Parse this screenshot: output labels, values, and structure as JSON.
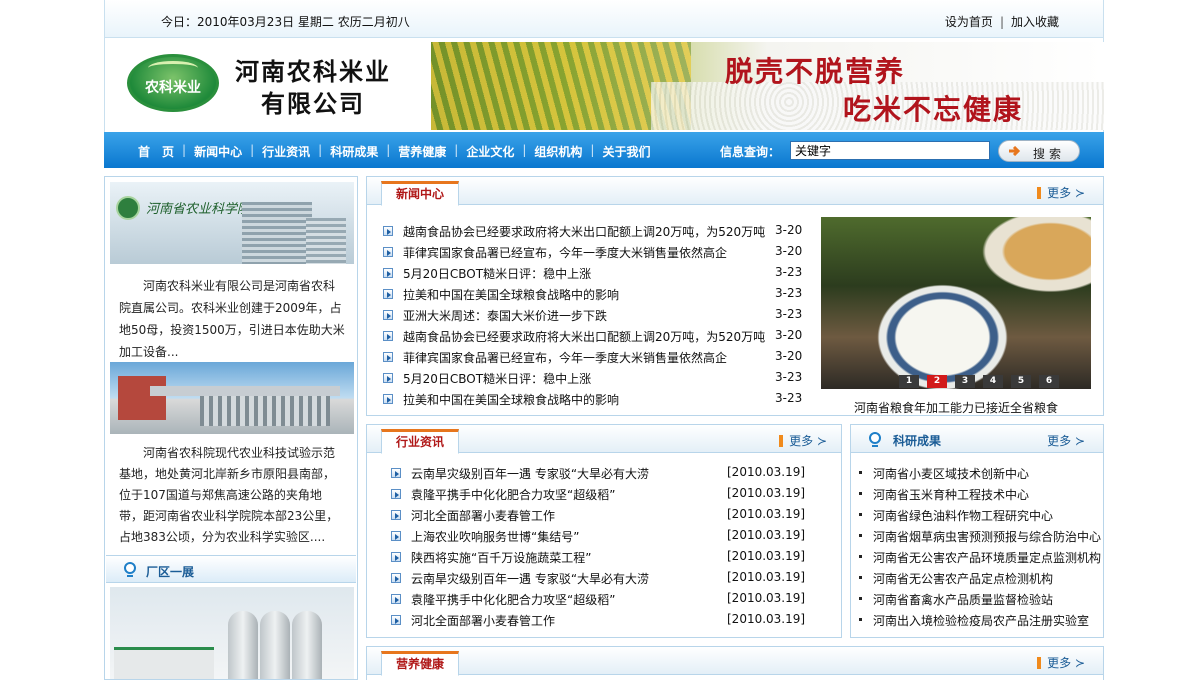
{
  "topbar": {
    "date": "今日：2010年03月23日  星期二  农历二月初八",
    "links": [
      "设为首页",
      "加入收藏"
    ]
  },
  "header": {
    "logo_text": "农科米业",
    "company_line1": "河南农科米业",
    "company_line2": "有限公司",
    "slogan1": "脱壳不脱营养",
    "slogan2": "吃米不忘健康"
  },
  "nav": {
    "items": [
      "首　页",
      "新闻中心",
      "行业资讯",
      "科研成果",
      "营养健康",
      "企业文化",
      "组织机构",
      "关于我们"
    ],
    "query_label": "信息查询：",
    "query_value": "关键字",
    "search_label": "搜索"
  },
  "left": {
    "pic1_caption": "河南省农业科学院",
    "intro": "河南农科米业有限公司是河南省农科院直属公司。农科米业创建于2009年，占地50母，投资1500万，引进日本佐助大米加工设备...",
    "base_text": "河南省农科院现代农业科技试验示范基地，地处黄河北岸新乡市原阳县南部，位于107国道与郑焦高速公路的夹角地带，距河南省农业科学院院本部23公里，占地383公顷，分为农业科学实验区....",
    "factory_title": "厂区一展"
  },
  "news": {
    "title": "新闻中心",
    "more": "更多",
    "items": [
      {
        "title": "越南食品协会已经要求政府将大米出口配额上调20万吨，为520万吨",
        "date": "3-20"
      },
      {
        "title": "菲律宾国家食品署已经宣布，今年一季度大米销售量依然高企",
        "date": "3-20"
      },
      {
        "title": "5月20日CBOT糙米日评：稳中上涨",
        "date": "3-23"
      },
      {
        "title": "拉美和中国在美国全球粮食战略中的影响",
        "date": "3-23"
      },
      {
        "title": "亚洲大米周述：泰国大米价进一步下跌",
        "date": "3-23"
      },
      {
        "title": "越南食品协会已经要求政府将大米出口配额上调20万吨，为520万吨",
        "date": "3-20"
      },
      {
        "title": "菲律宾国家食品署已经宣布，今年一季度大米销售量依然高企",
        "date": "3-20"
      },
      {
        "title": "5月20日CBOT糙米日评：稳中上涨",
        "date": "3-23"
      },
      {
        "title": "拉美和中国在美国全球粮食战略中的影响",
        "date": "3-23"
      }
    ],
    "slides": [
      "1",
      "2",
      "3",
      "4",
      "5",
      "6"
    ],
    "active_slide": "2",
    "photo_caption": "河南省粮食年加工能力已接近全省粮食"
  },
  "industry": {
    "title": "行业资讯",
    "more": "更多",
    "items": [
      {
        "title": "云南旱灾级别百年一遇 专家驳“大旱必有大涝",
        "date": "[2010.03.19]"
      },
      {
        "title": "袁隆平携手中化化肥合力攻坚“超级稻”",
        "date": "[2010.03.19]"
      },
      {
        "title": "河北全面部署小麦春管工作",
        "date": "[2010.03.19]"
      },
      {
        "title": "上海农业吹响服务世博“集结号”",
        "date": "[2010.03.19]"
      },
      {
        "title": "陕西将实施“百千万设施蔬菜工程”",
        "date": "[2010.03.19]"
      },
      {
        "title": "云南旱灾级别百年一遇 专家驳“大旱必有大涝",
        "date": "[2010.03.19]"
      },
      {
        "title": "袁隆平携手中化化肥合力攻坚“超级稻”",
        "date": "[2010.03.19]"
      },
      {
        "title": "河北全面部署小麦春管工作",
        "date": "[2010.03.19]"
      }
    ]
  },
  "research": {
    "title": "科研成果",
    "more": "更多",
    "items": [
      "河南省小麦区域技术创新中心",
      "河南省玉米育种工程技术中心",
      "河南省绿色油料作物工程研究中心",
      "河南省烟草病虫害预测预报与综合防治中心",
      "河南省无公害农产品环境质量定点监测机构",
      "河南省无公害农产品定点检测机构",
      "河南省畜禽水产品质量监督检验站",
      "河南出入境检验检疫局农产品注册实验室"
    ]
  },
  "health": {
    "title": "营养健康",
    "more": "更多"
  },
  "colors": {
    "nav_blue": "#0a77cf",
    "tab_red": "#b01818",
    "accent_orange": "#e7761d"
  }
}
